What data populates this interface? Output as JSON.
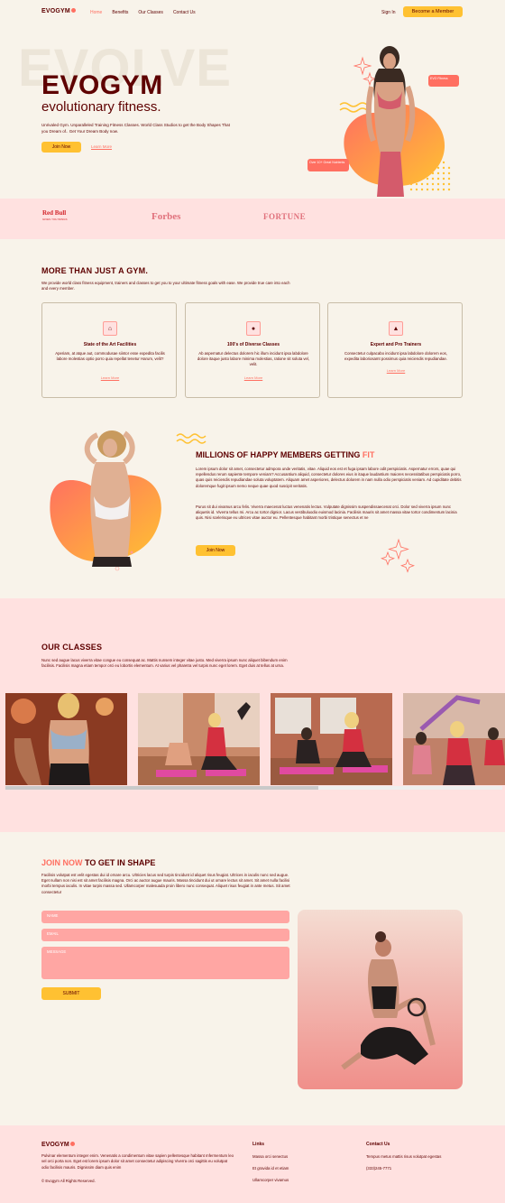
{
  "nav": {
    "logo": "EVOGYM",
    "links": [
      "Home",
      "Benefits",
      "Our Classes",
      "Contact Us"
    ],
    "sign_in": "Sign In",
    "cta": "Become a Member"
  },
  "hero": {
    "bg_word": "EVOLVE",
    "title": "EVOGYM",
    "subtitle": "evolutionary fitness.",
    "text": "Unrivaled Gym. Unparalleled Training Fitness Classes. World Class Studios to get the Body Shapes That you Dream of.. Get Your Dream Body now.",
    "join": "Join Now",
    "learn": "Learn More",
    "badge1": "EVO Fitness",
    "badge2": "Over 10+ Great Nutrients"
  },
  "sponsors": {
    "redbull": "Red Bull",
    "redbull_sub": "GIVES YOU WINGS",
    "forbes": "Forbes",
    "fortune": "FORTUNE"
  },
  "benefits": {
    "title": "MORE THAN JUST A GYM.",
    "text": "We provide world class fitness equipment, trainers and classes to get you to your ultimate fitness goals with ease. We provide true care into each and every member.",
    "cards": [
      {
        "icon": "home-icon",
        "title": "State of the Art Facilities",
        "text": "Aperiam, at atque aut, commodusae siintor esse expedita facilis labore molestias optio porro quia repellat tenetur Harum, velit?",
        "link": "Learn More"
      },
      {
        "icon": "group-icon",
        "title": "100's of Diverse Classes",
        "text": "Ab aspernatur delectus dolorem hic illum incidunt ipsa labdolore dolore itaque justo labore minima molestias, ratione sit soluta vel, velit.",
        "link": "Learn More"
      },
      {
        "icon": "academic-cap-icon",
        "title": "Expert and Pro Trainers",
        "text": "Consectetur culpacabo incidunt ipsa labdolore dolorem eos, expedita laboriosamt possimus quia reiciendis repudiandae.",
        "link": "Learn More"
      }
    ]
  },
  "millions": {
    "title_a": "MILLIONS OF HAPPY MEMBERS GETTING ",
    "title_b": "FIT",
    "p1": "Lorem ipsum dolor sit amet, consectetur admpora unde veritatis, vitae. Aliquid eos est et fuga ipsam labore odit perspiciatis. Aspernatur errors, quae qui repellendus rerum sapiente tempore veniam? Accusantium aliquid, consectetur dolores eius in itaque laudantium maiores necessitatibus perspiciatis porro, quas quis reiciendis repudiandae soluta voluptatem. Aliquam amet asperiores, delectus dolorem in nam nulla odio perspiciatis veniam. Ad cupiditate debitis doloremque fugit ipsum nemo neque quae quod suscipit veritatis.",
    "p2": "Purus sit dui vivamus arcu felis. Viverra maecenat luctus venenatis lectus. Vulputate dignissim suspendissaecenat orci. Dolor sed viverra ipsum nunc aliquetis id. Viverra tellus mi. Arcu ac tortor dignior. Lacus vestibuluodio euismod lacinia. Facilisis mauris sit amet massa vitae tortor condimentum lacinia quis. Nisi scelerisque eu ultrices vitae auctor eu. Pellentesque habitant morbi tristique senectus et ne",
    "join": "Join Now"
  },
  "classes": {
    "title": "OUR CLASSES",
    "text": "Nunc sed augue lacus viverra vitae congue eu consequat ac. Mattis nunsem integer vitae justo. Med viverra ipsum nunc aliquet bibendum enim facilisis. Facilisis magna etiam tempor orci eu lobortis elementum. At varius vel pharetra vel turpis nunc eget lorem. Eget duis at tellus at urna.",
    "progress": 0.63
  },
  "join": {
    "title_a": "JOIN NOW",
    "title_b": " TO GET IN SHAPE",
    "text": "Facilisis volutpat est velit egestas dui id ornare arcu. Ultricies lacus sed turpis tincidunt id aliquet risus feugiat. Ultrices in iaculis nunc sed augue. Eget nullam non nisi est sit amet facilisis magna. Orci ac auctor augue mauris. Massa tincidunt dui ut ornare lectus sit amet. Sit amet nulla facilisi morbi tempus iaculis. In vitae turpis massa sed. Ullamcorper malesuada proin libero nunc consequat. Aliquet risus feugiat in ante metus. Sit amet consectetur",
    "name_ph": "NAME",
    "email_ph": "EMAIL",
    "message_ph": "MESSAGE",
    "submit": "SUBMIT"
  },
  "footer": {
    "logo": "EVOGYM",
    "text": "Pulvinar elementum integer enim. Venenatis a condimentum vitae sapien pellentesque habitant mfermentum leo vel orci porta non. Eget est lorem ipsum dolor sit amet consectetur adipiscing Viverra orci sagittis eu volutpat odio facilisis mauris. Dignissim diam quis enim",
    "copyright": "© Evogym All Rights Reserved.",
    "links_head": "Links",
    "links": [
      "Massa orci senectus",
      "Et gravida id et etiam",
      "Ullamcorper vivamus"
    ],
    "contact_head": "Contact Us",
    "contact_text": "Tempus metus mattis risus volutpat egestas",
    "phone": "(333)245-7771"
  },
  "colors": {
    "primary": "#5e0000",
    "accent": "#ff6f61",
    "yellow": "#ffc132",
    "pink_bg": "#ffe1e0",
    "page_bg": "#f8f3ea"
  }
}
